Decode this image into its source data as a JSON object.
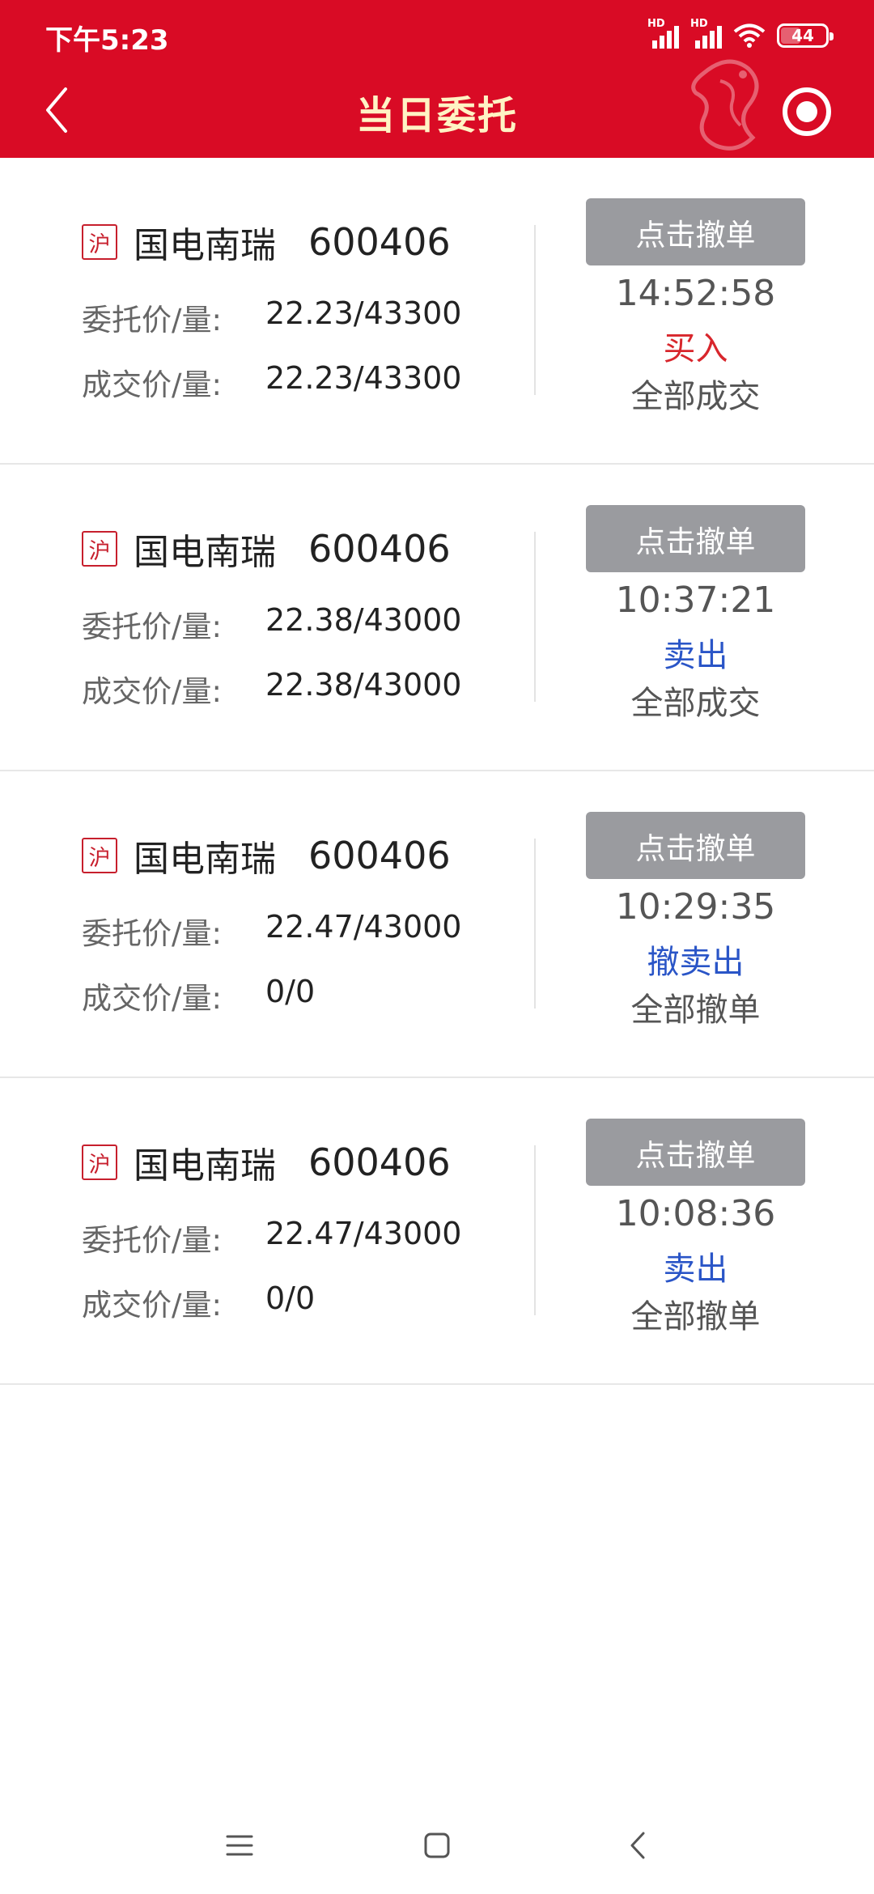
{
  "status_bar": {
    "time": "下午5:23",
    "hd1": "HD",
    "hd2": "HD",
    "battery": "44"
  },
  "header": {
    "title": "当日委托",
    "back_icon": "chevron-left-icon",
    "right_icon": "target-icon",
    "decoration": "dragon-logo",
    "bg_color": "#d90b25",
    "title_color": "#fff3c4"
  },
  "labels": {
    "order_price_qty": "委托价/量:",
    "deal_price_qty": "成交价/量:",
    "cancel_button": "点击撤单"
  },
  "orders": [
    {
      "market": "沪",
      "name": "国电南瑞",
      "code": "600406",
      "order_price_qty": "22.23/43300",
      "deal_price_qty": "22.23/43300",
      "time": "14:52:58",
      "side": "买入",
      "side_color": "#d8262c",
      "status": "全部成交"
    },
    {
      "market": "沪",
      "name": "国电南瑞",
      "code": "600406",
      "order_price_qty": "22.38/43000",
      "deal_price_qty": "22.38/43000",
      "time": "10:37:21",
      "side": "卖出",
      "side_color": "#2a55c7",
      "status": "全部成交"
    },
    {
      "market": "沪",
      "name": "国电南瑞",
      "code": "600406",
      "order_price_qty": "22.47/43000",
      "deal_price_qty": "0/0",
      "time": "10:29:35",
      "side": "撤卖出",
      "side_color": "#2a55c7",
      "status": "全部撤单"
    },
    {
      "market": "沪",
      "name": "国电南瑞",
      "code": "600406",
      "order_price_qty": "22.47/43000",
      "deal_price_qty": "0/0",
      "time": "10:08:36",
      "side": "卖出",
      "side_color": "#2a55c7",
      "status": "全部撤单"
    }
  ],
  "nav_bar": {
    "icons": [
      "menu-icon",
      "home-icon",
      "back-icon"
    ]
  }
}
